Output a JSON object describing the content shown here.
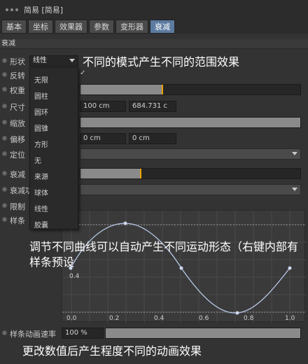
{
  "window": {
    "title": "简易 [简易]"
  },
  "tabs": [
    {
      "label": "基本",
      "active": false
    },
    {
      "label": "坐标",
      "active": false
    },
    {
      "label": "效果器",
      "active": false
    },
    {
      "label": "参数",
      "active": false
    },
    {
      "label": "变形器",
      "active": false
    },
    {
      "label": "衰减",
      "active": true
    }
  ],
  "section": {
    "title": "衰减"
  },
  "params": {
    "shape": {
      "label": "形状",
      "value": "线性"
    },
    "invert": {
      "label": "反转"
    },
    "weight": {
      "label": "权重",
      "percent": 37
    },
    "size": {
      "label": "尺寸",
      "value1": "100 cm",
      "value2": "684.731 c"
    },
    "scale": {
      "label": "缩放"
    },
    "offset": {
      "label": "偏移",
      "value1": "0 cm",
      "value2": "0 cm"
    },
    "orientation": {
      "label": "定位"
    },
    "falloff": {
      "label": "衰减",
      "percent": 27
    },
    "falloff_func": {
      "label": "衰减功"
    },
    "limit": {
      "label": "限制"
    },
    "spline": {
      "label": "样条"
    },
    "spline_speed": {
      "label": "样条动画速率",
      "value": "100 %"
    }
  },
  "shape_dropdown": {
    "options": [
      "无限",
      "圆柱",
      "圆环",
      "圆锥",
      "方形",
      "无",
      "来源",
      "球体",
      "线性",
      "胶囊"
    ]
  },
  "graph": {
    "x_ticks": [
      "0.0",
      "0.2",
      "0.4",
      "0.6",
      "0.8",
      "1.0"
    ],
    "y_tick": "0.4"
  },
  "annotations": {
    "top": "不同的模式产生不同的范围效果",
    "middle": "调节不同曲线可以自动产生不同运动形态（右键内部有样条预设",
    "bottom": "更改数值后产生程度不同的动画效果"
  },
  "colors": {
    "accent": "#f0a000",
    "tab_active": "#5c7ba0"
  }
}
